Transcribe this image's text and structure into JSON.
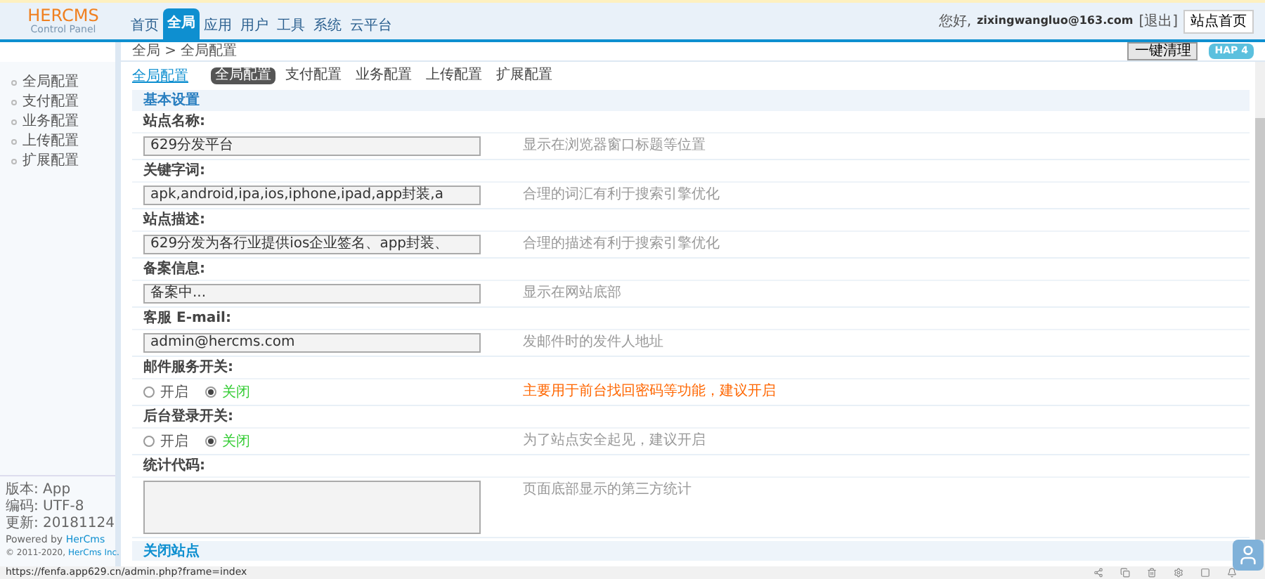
{
  "header": {
    "logo": "HERCMS",
    "subtitle": "Control Panel",
    "nav": [
      {
        "label": "首页",
        "selected": false
      },
      {
        "label": "全局",
        "selected": true
      },
      {
        "label": "应用",
        "selected": false
      },
      {
        "label": "用户",
        "selected": false
      },
      {
        "label": "工具",
        "selected": false
      },
      {
        "label": "系统",
        "selected": false
      },
      {
        "label": "云平台",
        "selected": false
      }
    ],
    "greeting": "您好,",
    "user": "zixingwangluo@163.com",
    "logout": "[退出]",
    "home_button": "站点首页"
  },
  "breadcrumb": "全局 > 全局配置",
  "toolbar_button": "一键清理",
  "version_badge": "HAP 4",
  "sidebar": {
    "items": [
      {
        "label": "全局配置",
        "selected": false
      },
      {
        "label": "支付配置",
        "selected": false
      },
      {
        "label": "业务配置",
        "selected": false
      },
      {
        "label": "上传配置",
        "selected": false
      },
      {
        "label": "扩展配置",
        "selected": false
      }
    ],
    "footer": [
      "版本: App",
      "编码: UTF-8",
      "更新: 20181124"
    ],
    "powered_by": "Powered by",
    "powered_link": "HerCms",
    "copyright": "© 2011-2020,",
    "copyright_link": "HerCms Inc."
  },
  "page_title": "全局配置",
  "tabs": [
    {
      "label": "全局配置",
      "selected": true
    },
    {
      "label": "支付配置",
      "selected": false
    },
    {
      "label": "业务配置",
      "selected": false
    },
    {
      "label": "上传配置",
      "selected": false
    },
    {
      "label": "扩展配置",
      "selected": false
    }
  ],
  "section": "基本设置",
  "fields": [
    {
      "kind": "text",
      "label": "站点名称:",
      "value": "629分发平台",
      "hint": "显示在浏览器窗口标题等位置",
      "warning": false
    },
    {
      "kind": "text",
      "label": "关键字词:",
      "value": "apk,android,ipa,ios,iphone,ipad,app封装,a",
      "hint": "合理的词汇有利于搜索引擎优化",
      "warning": false
    },
    {
      "kind": "text",
      "label": "站点描述:",
      "value": "629分发为各行业提供ios企业签名、app封装、",
      "hint": "合理的描述有利于搜索引擎优化",
      "warning": false
    },
    {
      "kind": "text",
      "label": "备案信息:",
      "value": "备案中...",
      "hint": "显示在网站底部",
      "warning": false
    },
    {
      "kind": "text",
      "label": "客服 E-mail:",
      "value": "admin@hercms.com",
      "hint": "发邮件时的发件人地址",
      "warning": false
    },
    {
      "kind": "radio",
      "label": "邮件服务开关:",
      "options": [
        {
          "label": "开启",
          "selected": false
        },
        {
          "label": "关闭",
          "selected": true
        }
      ],
      "hint": "主要用于前台找回密码等功能，建议开启",
      "warning": true
    },
    {
      "kind": "radio",
      "label": "后台登录开关:",
      "options": [
        {
          "label": "开启",
          "selected": false
        },
        {
          "label": "关闭",
          "selected": true
        }
      ],
      "hint": "为了站点安全起见，建议开启",
      "warning": false
    },
    {
      "kind": "textarea",
      "label": "统计代码:",
      "hint": "页面底部显示的第三方统计",
      "warning": false
    }
  ],
  "next_section": "关闭站点",
  "status_url": "https://fenfa.app629.cn/admin.php?frame=index"
}
